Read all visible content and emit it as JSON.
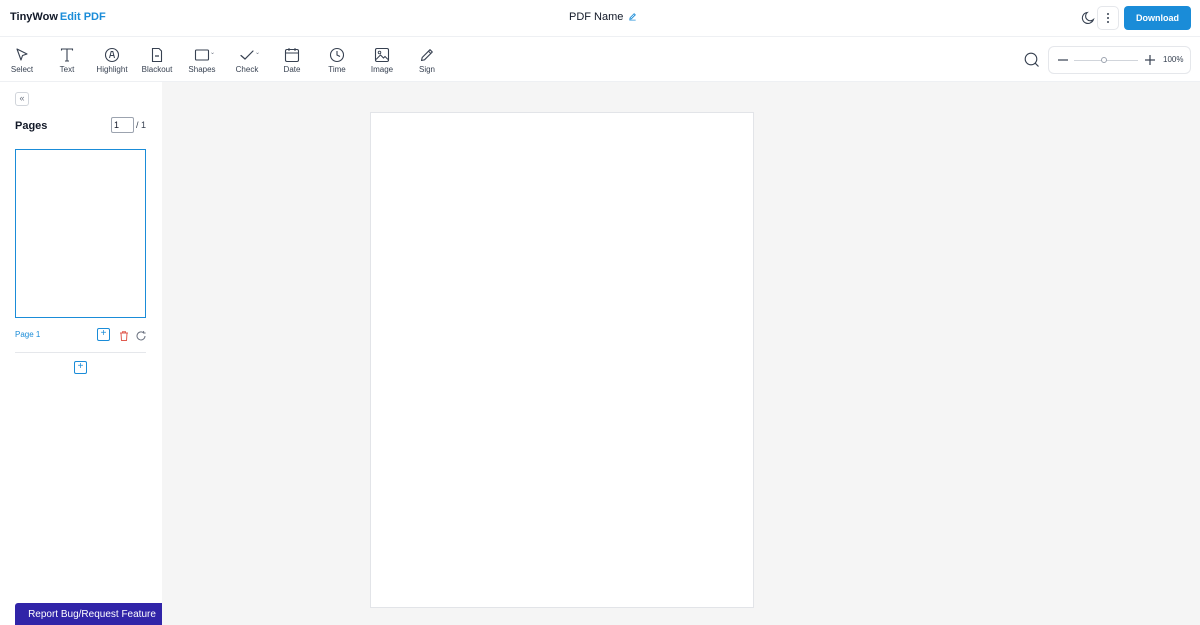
{
  "header": {
    "brand_name": "TinyWow",
    "brand_tool": "Edit PDF",
    "document_title": "PDF Name",
    "download_label": "Download"
  },
  "toolbar": {
    "tools": [
      {
        "label": "Select",
        "icon": "cursor-icon"
      },
      {
        "label": "Text",
        "icon": "text-icon"
      },
      {
        "label": "Highlight",
        "icon": "highlight-icon"
      },
      {
        "label": "Blackout",
        "icon": "blackout-icon"
      },
      {
        "label": "Shapes",
        "icon": "rectangle-icon"
      },
      {
        "label": "Check",
        "icon": "checkmark-icon"
      },
      {
        "label": "Date",
        "icon": "calendar-icon"
      },
      {
        "label": "Time",
        "icon": "clock-icon"
      },
      {
        "label": "Image",
        "icon": "image-icon"
      },
      {
        "label": "Sign",
        "icon": "pen-icon"
      }
    ],
    "zoom_label": "100%"
  },
  "sidebar": {
    "collapse_symbol": "«",
    "title": "Pages",
    "current_page": "1",
    "total_pages": "/ 1",
    "pages": [
      {
        "label": "Page 1"
      }
    ]
  },
  "footer": {
    "report_label": "Report Bug/Request Feature"
  },
  "colors": {
    "accent": "#1a8cd8",
    "report_button": "#3024a8",
    "canvas_bg": "#f5f5f5"
  }
}
